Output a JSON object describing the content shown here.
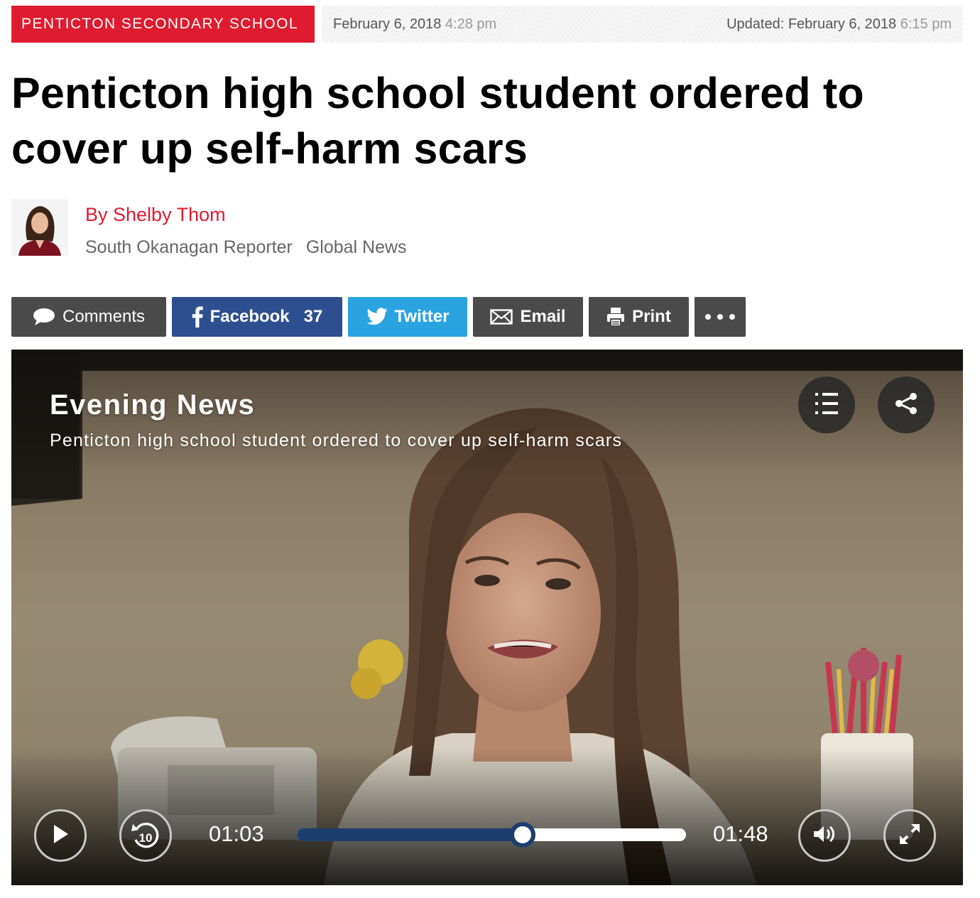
{
  "colors": {
    "brand_red": "#df1b2f",
    "facebook_blue": "#2e4f8f",
    "twitter_blue": "#2aa3e0",
    "button_gray": "#4a4a4a",
    "progress_navy": "#1c3e6e"
  },
  "meta": {
    "category": "PENTICTON SECONDARY SCHOOL",
    "published_date": "February 6, 2018",
    "published_time": "4:28 pm",
    "updated_label": "Updated:",
    "updated_date": "February 6, 2018",
    "updated_time": "6:15 pm"
  },
  "article": {
    "headline": "Penticton high school student ordered to cover up self-harm scars"
  },
  "byline": {
    "author": "By Shelby Thom",
    "role": "South Okanagan Reporter",
    "outlet": "Global News"
  },
  "share": {
    "comments": {
      "label": "Comments",
      "icon": "speech-bubble-icon"
    },
    "facebook": {
      "label": "Facebook",
      "count": "37",
      "icon": "facebook-icon"
    },
    "twitter": {
      "label": "Twitter",
      "icon": "twitter-bird-icon"
    },
    "email": {
      "label": "Email",
      "icon": "envelope-icon"
    },
    "print": {
      "label": "Print",
      "icon": "printer-icon"
    },
    "more": {
      "label": "...",
      "icon": "more-dots-icon"
    }
  },
  "video": {
    "show": "Evening News",
    "title": "Penticton high school student ordered to cover up self-harm scars",
    "current_time": "01:03",
    "duration": "01:48",
    "progress": 0.58,
    "replay_seconds": "10",
    "controls": {
      "play": "play-icon",
      "rewind": "rewind-10-icon",
      "volume": "volume-icon",
      "fullscreen": "fullscreen-icon",
      "playlist": "playlist-icon",
      "share": "share-icon"
    }
  }
}
